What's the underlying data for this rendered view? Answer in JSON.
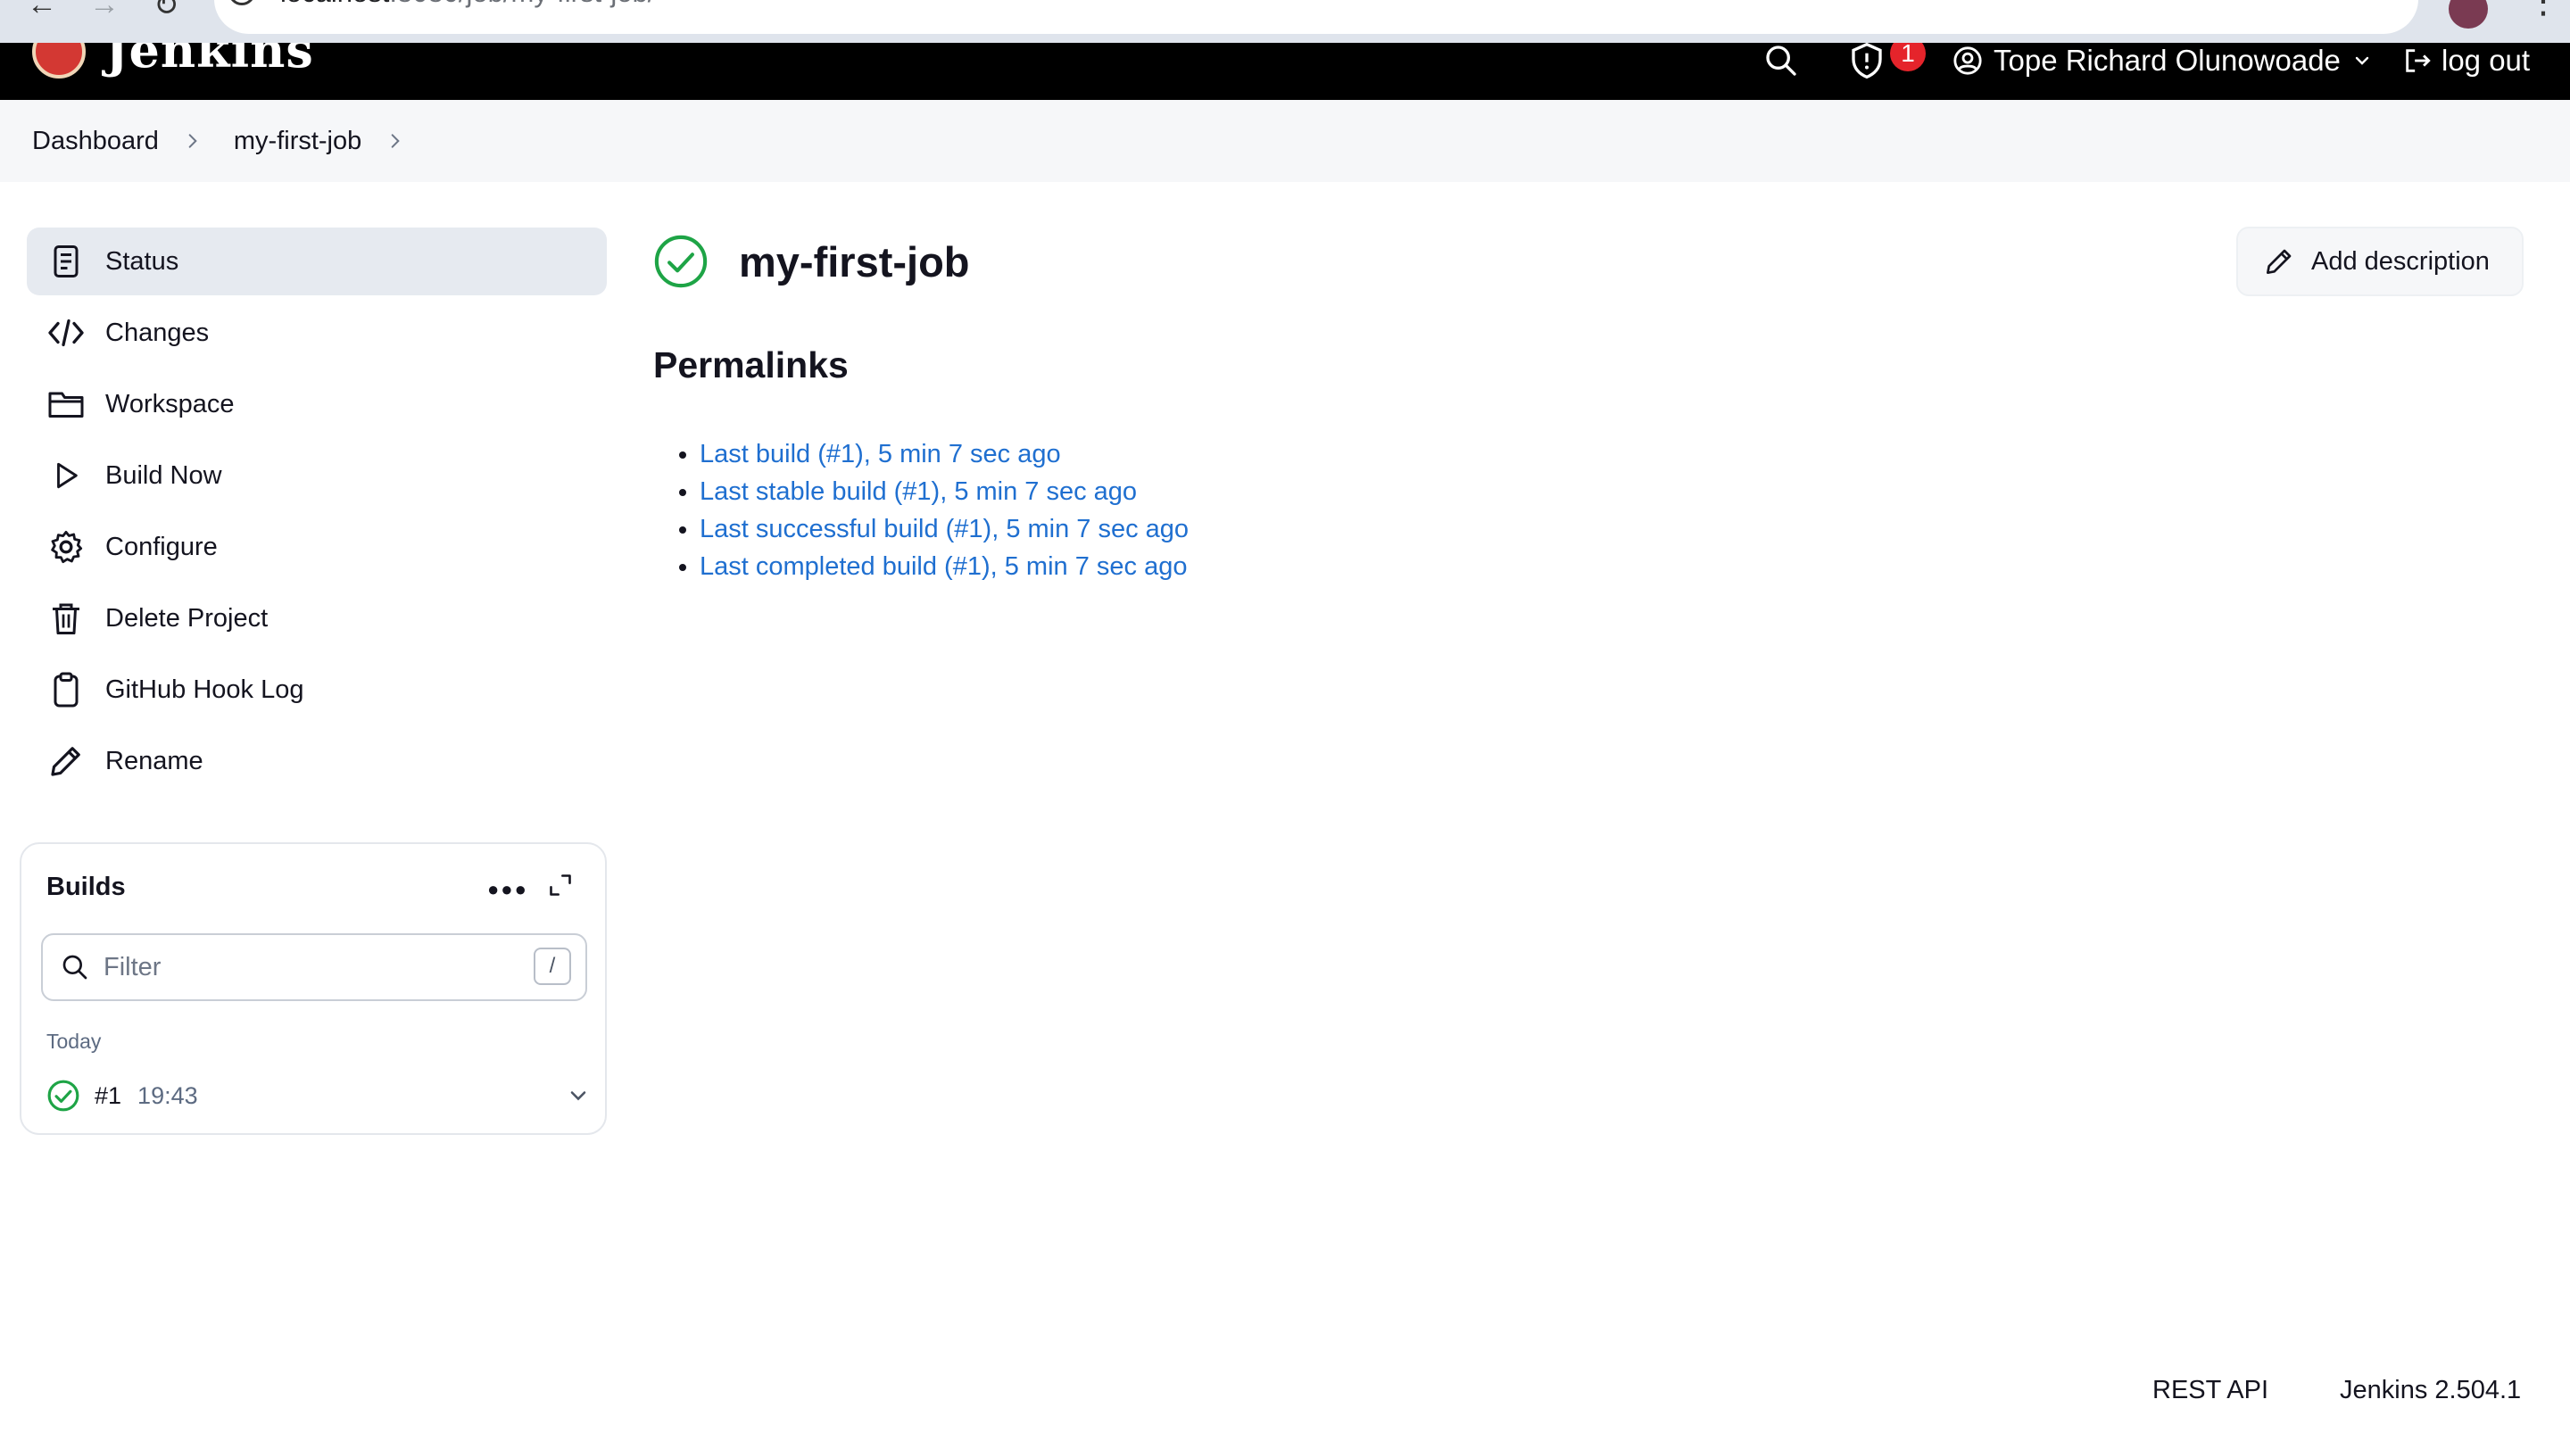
{
  "browser": {
    "url_host": "localhost",
    "url_rest": ":8080/job/my-first-job/"
  },
  "header": {
    "app_title": "Jenkins",
    "notification_count": "1",
    "user_name": "Tope Richard Olunowoade",
    "logout_label": "log out"
  },
  "breadcrumb": {
    "items": [
      "Dashboard",
      "my-first-job"
    ]
  },
  "sidebar": {
    "tasks": [
      {
        "label": "Status",
        "icon": "status-icon",
        "active": true
      },
      {
        "label": "Changes",
        "icon": "code-icon"
      },
      {
        "label": "Workspace",
        "icon": "folder-icon"
      },
      {
        "label": "Build Now",
        "icon": "play-icon"
      },
      {
        "label": "Configure",
        "icon": "gear-icon"
      },
      {
        "label": "Delete Project",
        "icon": "trash-icon"
      },
      {
        "label": "GitHub Hook Log",
        "icon": "clipboard-icon"
      },
      {
        "label": "Rename",
        "icon": "pencil-icon"
      }
    ]
  },
  "builds": {
    "title": "Builds",
    "filter_placeholder": "Filter",
    "filter_shortcut": "/",
    "group_label": "Today",
    "items": [
      {
        "number": "#1",
        "time": "19:43",
        "status": "success"
      }
    ]
  },
  "main": {
    "job_name": "my-first-job",
    "add_description_label": "Add description",
    "permalinks_heading": "Permalinks",
    "permalinks": [
      "Last build (#1), 5 min 7 sec ago",
      "Last stable build (#1), 5 min 7 sec ago",
      "Last successful build (#1), 5 min 7 sec ago",
      "Last completed build (#1), 5 min 7 sec ago"
    ]
  },
  "footer": {
    "rest_api_label": "REST API",
    "version_label": "Jenkins 2.504.1"
  },
  "colors": {
    "header_bg": "#000000",
    "success_green": "#1ea446",
    "link_blue": "#1f6fd0",
    "badge_red": "#e5242b"
  }
}
